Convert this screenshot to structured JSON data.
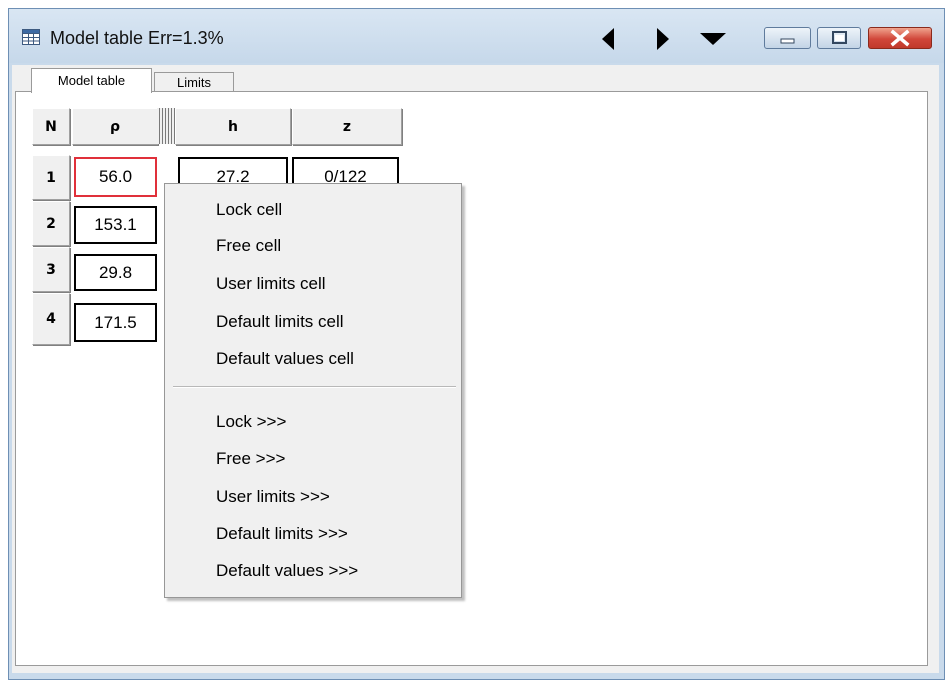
{
  "window": {
    "title": "Model table Err=1.3%",
    "icons": {
      "app": "table-icon",
      "prev": "triangle-left-icon",
      "next": "triangle-right-icon",
      "dropdown": "triangle-down-icon",
      "minimize": "minimize-icon",
      "restore": "restore-icon",
      "close": "close-icon"
    }
  },
  "tabs": [
    {
      "label": "Model table",
      "active": true
    },
    {
      "label": "Limits",
      "active": false
    }
  ],
  "table": {
    "columns": [
      "N",
      "ρ",
      "h",
      "z"
    ],
    "rows": [
      {
        "n": "1",
        "rho": "56.0",
        "h": "27.2",
        "z": "0/122"
      },
      {
        "n": "2",
        "rho": "153.1"
      },
      {
        "n": "3",
        "rho": "29.8"
      },
      {
        "n": "4",
        "rho": "171.5"
      }
    ]
  },
  "context_menu": {
    "cell_items": [
      "Lock cell",
      "Free cell",
      "User limits cell",
      "Default limits cell",
      "Default values cell"
    ],
    "column_items": [
      "Lock >>>",
      "Free >>>",
      "User limits >>>",
      "Default limits >>>",
      "Default values >>>"
    ]
  },
  "colors": {
    "selected_cell_border": "#e0303a",
    "close_button": "#c9483a",
    "title_bar": "#c9daeb"
  }
}
